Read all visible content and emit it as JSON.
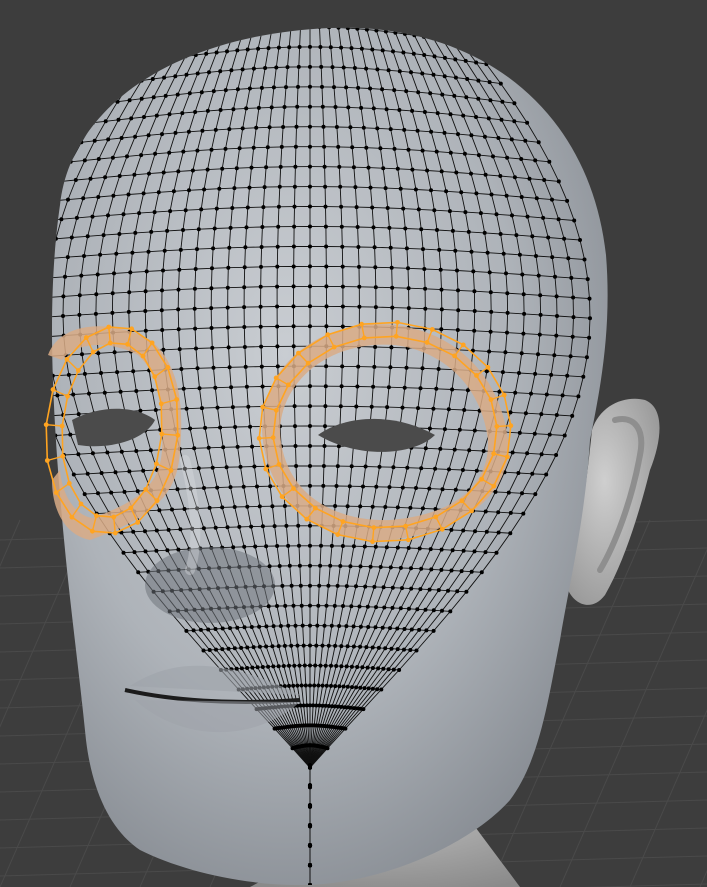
{
  "viewport": {
    "mode": "edit-mode",
    "colors": {
      "background": "#3d3d3d",
      "floor_grid": "#4a4a4a",
      "mesh_surface": "#aeb3b9",
      "mesh_shadow": "#7c8188",
      "mesh_highlight": "#d1d5da",
      "wire": "#101010",
      "vertex": "#000000",
      "selected_wire": "#ffa421",
      "selected_face": "#d9ab86",
      "ear": "#b6b6b6"
    }
  },
  "mesh": {
    "object": "head",
    "selection": "eye-socket-edge-loops",
    "selected_loops": [
      "right-eye-loop",
      "left-eye-loop"
    ]
  }
}
